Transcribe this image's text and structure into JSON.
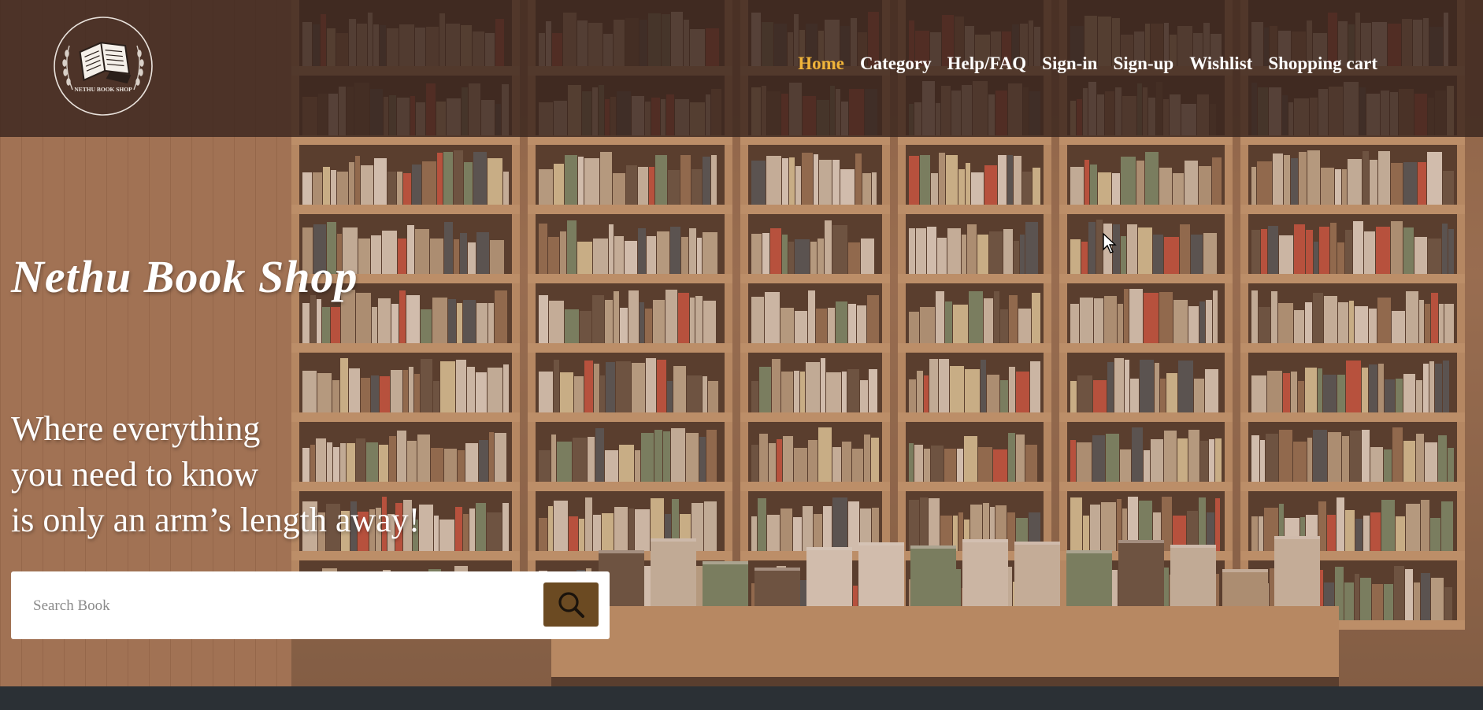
{
  "header": {
    "logo_text": "NETHU BOOK SHOP",
    "nav": [
      {
        "label": "Home",
        "active": true
      },
      {
        "label": "Category",
        "active": false
      },
      {
        "label": "Help/FAQ",
        "active": false
      },
      {
        "label": "Sign-in",
        "active": false
      },
      {
        "label": "Sign-up",
        "active": false
      },
      {
        "label": "Wishlist",
        "active": false
      },
      {
        "label": "Shopping cart",
        "active": false
      }
    ]
  },
  "hero": {
    "brand": "Nethu Book Shop",
    "tagline": [
      "Where everything",
      "you need to know",
      "is only an arm’s length away!"
    ]
  },
  "search": {
    "placeholder": "Search Book",
    "value": ""
  },
  "colors": {
    "header_overlay": "#3a261e",
    "nav_active": "#f0b43a",
    "nav_text": "#ffffff",
    "search_button": "#6b4a22",
    "footer": "#2b3035"
  },
  "icons": {
    "search_button_icon": "magnifier-icon",
    "logo_icon": "open-book-icon"
  }
}
